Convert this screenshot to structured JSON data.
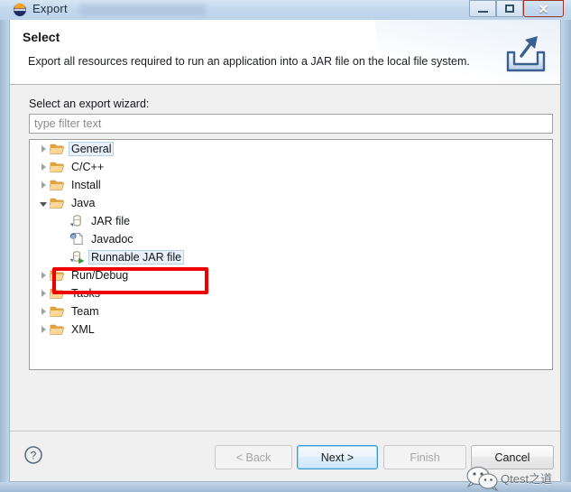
{
  "window": {
    "title": "Export",
    "icon": "eclipse-icon",
    "controls": {
      "minimize_label": "–",
      "maximize_label": "□",
      "close_label": "✕"
    }
  },
  "header": {
    "title": "Select",
    "description": "Export all resources required to run an application into a JAR file on the local file system.",
    "icon": "export-wizard-icon"
  },
  "body": {
    "wizard_label": "Select an export wizard:",
    "filter": {
      "placeholder": "type filter text",
      "value": ""
    },
    "tree": [
      {
        "label": "General",
        "icon": "folder-icon",
        "depth": 0,
        "state": "collapsed",
        "selected": true,
        "highlighted": false
      },
      {
        "label": "C/C++",
        "icon": "folder-icon",
        "depth": 0,
        "state": "collapsed",
        "selected": false,
        "highlighted": false
      },
      {
        "label": "Install",
        "icon": "folder-icon",
        "depth": 0,
        "state": "collapsed",
        "selected": false,
        "highlighted": false
      },
      {
        "label": "Java",
        "icon": "folder-icon",
        "depth": 0,
        "state": "expanded",
        "selected": false,
        "highlighted": false
      },
      {
        "label": "JAR file",
        "icon": "jar-file-icon",
        "depth": 1,
        "state": "leaf",
        "selected": false,
        "highlighted": false
      },
      {
        "label": "Javadoc",
        "icon": "javadoc-icon",
        "depth": 1,
        "state": "leaf",
        "selected": false,
        "highlighted": false
      },
      {
        "label": "Runnable JAR file",
        "icon": "runnable-jar-icon",
        "depth": 1,
        "state": "leaf",
        "selected": true,
        "highlighted": true
      },
      {
        "label": "Run/Debug",
        "icon": "folder-icon",
        "depth": 0,
        "state": "collapsed",
        "selected": false,
        "highlighted": false
      },
      {
        "label": "Tasks",
        "icon": "folder-icon",
        "depth": 0,
        "state": "collapsed",
        "selected": false,
        "highlighted": false
      },
      {
        "label": "Team",
        "icon": "folder-icon",
        "depth": 0,
        "state": "collapsed",
        "selected": false,
        "highlighted": false
      },
      {
        "label": "XML",
        "icon": "folder-icon",
        "depth": 0,
        "state": "collapsed",
        "selected": false,
        "highlighted": false
      }
    ]
  },
  "footer": {
    "help_icon": "help-question-icon",
    "buttons": [
      {
        "id": "back",
        "label": "< Back",
        "enabled": false,
        "default": false
      },
      {
        "id": "next",
        "label": "Next >",
        "enabled": true,
        "default": true
      },
      {
        "id": "finish",
        "label": "Finish",
        "enabled": false,
        "default": false
      },
      {
        "id": "cancel",
        "label": "Cancel",
        "enabled": true,
        "default": false
      }
    ]
  },
  "watermark": {
    "text": "Qtest之道",
    "icon": "wechat-icon"
  },
  "colors": {
    "highlight_red": "#ee0000",
    "default_button_blue": "#3c9ad6",
    "selection_blue": "#e8f1fb",
    "folder_yellow": "#f5c97a",
    "close_red": "#c23f31"
  }
}
